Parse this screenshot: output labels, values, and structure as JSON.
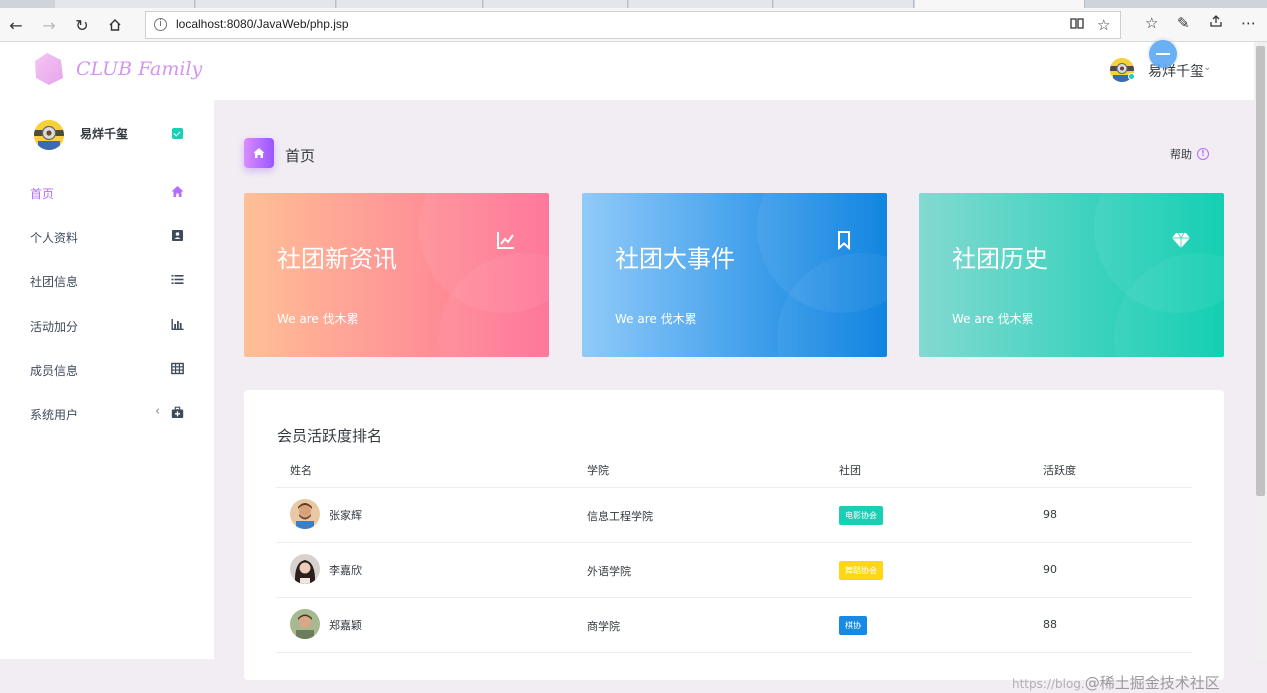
{
  "browser": {
    "url": "localhost:8080/JavaWeb/php.jsp"
  },
  "navbar": {
    "brand": "CLUB Family",
    "user_name": "易烊千玺"
  },
  "sidebar": {
    "user_name": "易烊千玺",
    "items": [
      {
        "label": "首页",
        "icon": "home-icon",
        "active": true
      },
      {
        "label": "个人资料",
        "icon": "contact-card-icon"
      },
      {
        "label": "社团信息",
        "icon": "list-icon"
      },
      {
        "label": "活动加分",
        "icon": "bar-chart-icon"
      },
      {
        "label": "成员信息",
        "icon": "table-icon"
      },
      {
        "label": "系统用户",
        "icon": "medical-bag-icon",
        "has_chevron": true
      }
    ]
  },
  "header": {
    "title": "首页",
    "help": "帮助"
  },
  "cards": [
    {
      "title": "社团新资讯",
      "subtitle": "We are 伐木累",
      "icon": "chart-line-icon",
      "gradient": [
        "#ffbf96",
        "#fe7096"
      ]
    },
    {
      "title": "社团大事件",
      "subtitle": "We are 伐木累",
      "icon": "bookmark-icon",
      "gradient": [
        "#90caf9",
        "#047edf"
      ]
    },
    {
      "title": "社团历史",
      "subtitle": "We are 伐木累",
      "icon": "diamond-icon",
      "gradient": [
        "#84d9d2",
        "#07cdae"
      ]
    }
  ],
  "ranking": {
    "title": "会员活跃度排名",
    "headers": [
      "姓名",
      "学院",
      "社团",
      "活跃度"
    ],
    "rows": [
      {
        "name": "张家辉",
        "college": "信息工程学院",
        "club": "电影协会",
        "club_color": "#1bcfb4",
        "score": "98"
      },
      {
        "name": "李嘉欣",
        "college": "外语学院",
        "club": "舞蹈协会",
        "club_color": "#fed713",
        "score": "90"
      },
      {
        "name": "郑嘉颖",
        "college": "商学院",
        "club": "棋协",
        "club_color": "#198ae3",
        "score": "88"
      }
    ]
  },
  "watermark": {
    "small": "https://blog.",
    "main": "@稀土掘金技术社区"
  }
}
